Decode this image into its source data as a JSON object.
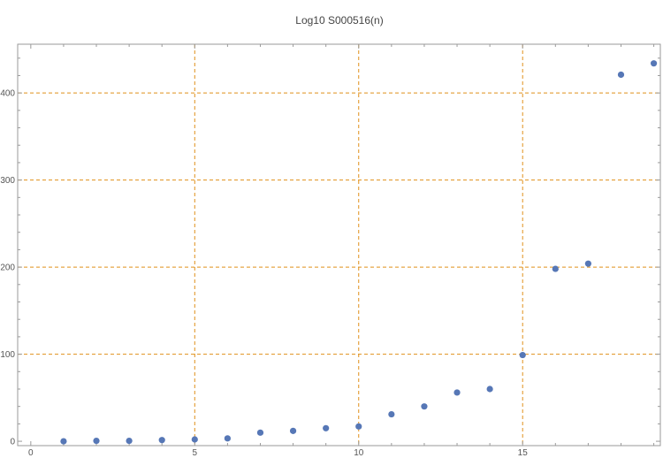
{
  "chart_data": {
    "type": "scatter",
    "title": "Log10 S000516(n)",
    "xlabel": "",
    "ylabel": "",
    "xlim": [
      -0.4,
      19.2
    ],
    "ylim": [
      -5,
      456
    ],
    "x_ticks": [
      0,
      5,
      10,
      15
    ],
    "y_ticks": [
      0,
      100,
      200,
      300,
      400
    ],
    "x_gridlines": [
      5,
      10,
      15
    ],
    "y_gridlines": [
      100,
      200,
      300,
      400
    ],
    "grid": true,
    "legend": "none",
    "series": [
      {
        "x": [
          1,
          2,
          3,
          4,
          5,
          6,
          7,
          8,
          9,
          10,
          11,
          12,
          13,
          14,
          15,
          16,
          17,
          18,
          19
        ],
        "y": [
          0,
          0.5,
          0.5,
          1.4,
          2.1,
          3.3,
          9.9,
          11.9,
          15,
          17,
          31,
          40,
          56,
          60,
          99,
          198,
          204,
          421,
          434
        ]
      }
    ]
  },
  "colors": {
    "marker": "#5677b6",
    "grid": "#e0901a",
    "frame": "#9a9a9a"
  }
}
